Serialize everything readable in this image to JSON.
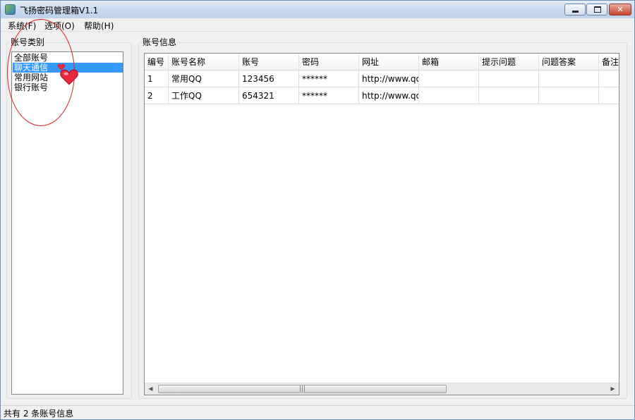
{
  "window": {
    "title": "飞扬密码管理箱V1.1",
    "controls": {
      "minimize": "minimize-icon",
      "maximize": "maximize-icon",
      "close": "✕"
    }
  },
  "menu": {
    "items": [
      {
        "label": "系统(F)"
      },
      {
        "label": "选项(O)"
      },
      {
        "label": "帮助(H)"
      }
    ]
  },
  "categories": {
    "title": "账号类别",
    "items": [
      {
        "label": "全部账号",
        "selected": false
      },
      {
        "label": "聊天通信",
        "selected": true
      },
      {
        "label": "常用网站",
        "selected": false
      },
      {
        "label": "银行账号",
        "selected": false
      }
    ]
  },
  "accounts": {
    "title": "账号信息",
    "columns": [
      "编号",
      "账号名称",
      "账号",
      "密码",
      "网址",
      "邮箱",
      "提示问题",
      "问题答案",
      "备注"
    ],
    "rows": [
      [
        "1",
        "常用QQ",
        "123456",
        "******",
        "http://www.qq",
        "",
        "",
        "",
        ""
      ],
      [
        "2",
        "工作QQ",
        "654321",
        "******",
        "http://www.qq",
        "",
        "",
        "",
        ""
      ]
    ]
  },
  "status": {
    "text": "共有 2 条账号信息"
  },
  "colors": {
    "selection": "#3399ff",
    "annotation": "#e02020",
    "heart": "#e8283c"
  },
  "annotation_icons": [
    "heart-icon"
  ]
}
